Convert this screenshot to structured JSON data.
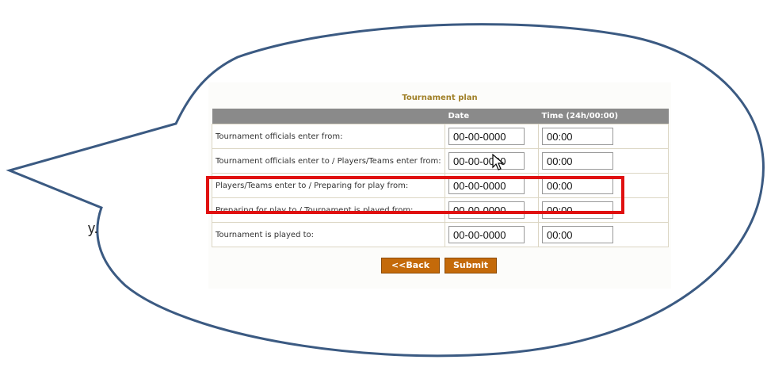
{
  "side_text": "y.",
  "plan": {
    "title": "Tournament plan",
    "columns": {
      "label": "",
      "date": "Date",
      "time": "Time (24h/00:00)"
    },
    "rows": [
      {
        "label": "Tournament officials enter from:",
        "date": "00-00-0000",
        "time": "00:00"
      },
      {
        "label": "Tournament officials enter to / Players/Teams enter from:",
        "date": "00-00-0000",
        "time": "00:00"
      },
      {
        "label": "Players/Teams enter to / Preparing for play from:",
        "date": "00-00-0000",
        "time": "00:00"
      },
      {
        "label": "Preparing for play to / Tournament is played from:",
        "date": "00-00-0000",
        "time": "00:00"
      },
      {
        "label": "Tournament is played to:",
        "date": "00-00-0000",
        "time": "00:00"
      }
    ],
    "back_label": "<<Back",
    "submit_label": "Submit"
  },
  "colors": {
    "bubble_stroke": "#3b5a82",
    "highlight": "#e01010",
    "header_bg": "#8a8a8a",
    "button_bg": "#c46a0a",
    "title": "#a08028"
  }
}
